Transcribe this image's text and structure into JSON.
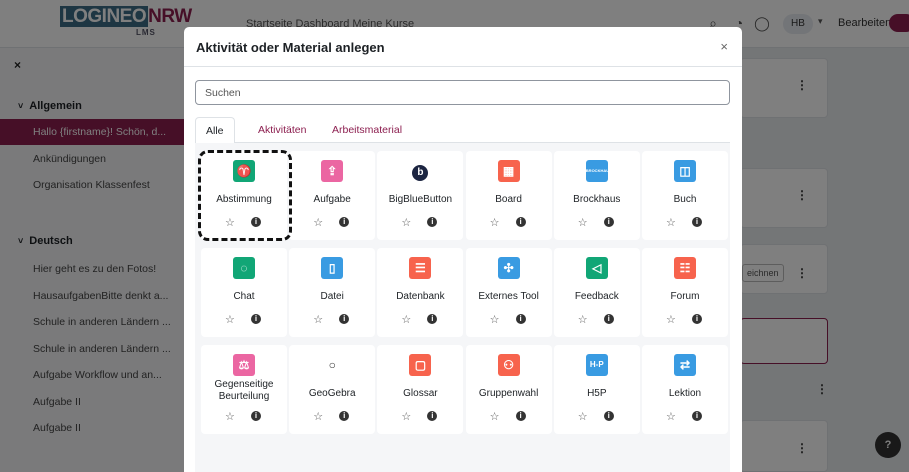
{
  "topbar": {
    "logo_a": "LOGINEO",
    "logo_b": "NRW",
    "logo_sub": "LMS",
    "nav_text": "Startseite   Dashboard   Meine Kurse",
    "avatar": "HB",
    "edit_label": "Bearbeiten"
  },
  "drawer": {
    "sections": [
      {
        "title": "Allgemein",
        "items": [
          "Hallo {firstname}! Schön, d...",
          "Ankündigungen",
          "Organisation Klassenfest"
        ]
      },
      {
        "title": "Deutsch",
        "items": [
          "Hier geht es zu den Fotos!",
          "HausaufgabenBitte denkt a...",
          "Schule in anderen Ländern ...",
          "Schule in anderen Ländern ...",
          "Aufgabe Workflow und an...",
          "Aufgabe II",
          "Aufgabe II"
        ]
      }
    ]
  },
  "background": {
    "partial_button": "eichnen",
    "help": "?"
  },
  "modal": {
    "title": "Aktivität oder Material anlegen",
    "close": "×",
    "search_placeholder": "Suchen",
    "tabs": [
      "Alle",
      "Aktivitäten",
      "Arbeitsmaterial"
    ],
    "tiles": [
      {
        "name": "Abstimmung",
        "icon": "choice-icon",
        "glyph": "♈",
        "color": "#11a676"
      },
      {
        "name": "Aufgabe",
        "icon": "assignment-icon",
        "glyph": "⇪",
        "color": "#eb66a2"
      },
      {
        "name": "BigBlueButton",
        "icon": "bigbluebutton-icon",
        "glyph": "b",
        "color": "#1c2541"
      },
      {
        "name": "Board",
        "icon": "board-icon",
        "glyph": "▦",
        "color": "#f7634d"
      },
      {
        "name": "Brockhaus",
        "icon": "brockhaus-icon",
        "glyph": "BROCKHAUS",
        "color": "#399be2"
      },
      {
        "name": "Buch",
        "icon": "book-icon",
        "glyph": "◫",
        "color": "#399be2"
      },
      {
        "name": "Chat",
        "icon": "chat-icon",
        "glyph": "◌",
        "color": "#11a676"
      },
      {
        "name": "Datei",
        "icon": "file-icon",
        "glyph": "▯",
        "color": "#399be2"
      },
      {
        "name": "Datenbank",
        "icon": "database-icon",
        "glyph": "☰",
        "color": "#f7634d"
      },
      {
        "name": "Externes Tool",
        "icon": "puzzle-icon",
        "glyph": "✣",
        "color": "#399be2"
      },
      {
        "name": "Feedback",
        "icon": "megaphone-icon",
        "glyph": "◁",
        "color": "#11a676"
      },
      {
        "name": "Forum",
        "icon": "forum-icon",
        "glyph": "☷",
        "color": "#f7634d"
      },
      {
        "name": "Gegenseitige Beurteilung",
        "icon": "workshop-icon",
        "glyph": "⚖",
        "color": "#eb66a2"
      },
      {
        "name": "GeoGebra",
        "icon": "geogebra-icon",
        "glyph": "○",
        "color": "#ffffff"
      },
      {
        "name": "Glossar",
        "icon": "glossary-icon",
        "glyph": "▢",
        "color": "#f7634d"
      },
      {
        "name": "Gruppenwahl",
        "icon": "group-choice-icon",
        "glyph": "⚇",
        "color": "#f7634d"
      },
      {
        "name": "H5P",
        "icon": "h5p-icon",
        "glyph": "H-P",
        "color": "#399be2"
      },
      {
        "name": "Lektion",
        "icon": "lesson-icon",
        "glyph": "⇄",
        "color": "#399be2"
      }
    ],
    "star": "☆",
    "info": "i"
  }
}
